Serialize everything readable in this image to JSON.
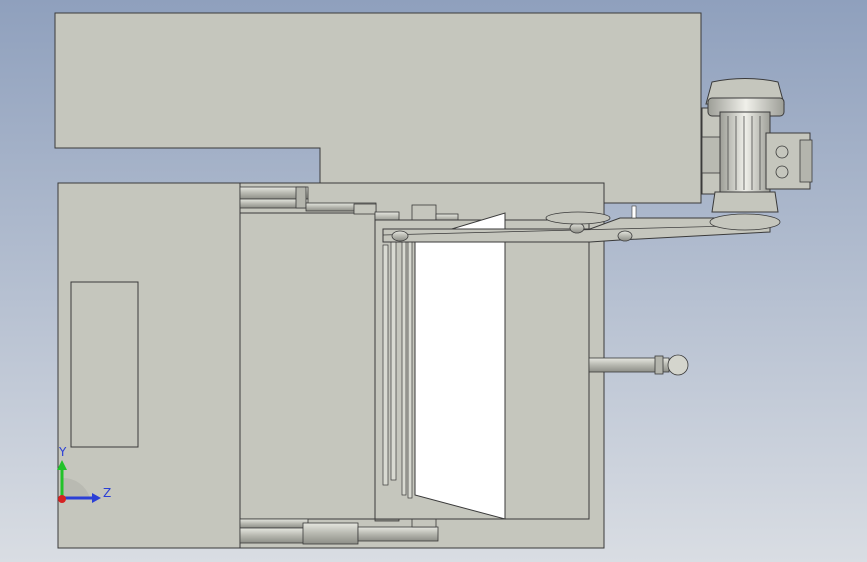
{
  "viewport": {
    "background_top": "#8fa0bd",
    "background_bottom": "#d9dde3"
  },
  "colors": {
    "part_fill": "#c5c6bd",
    "part_stroke": "#3a3a3a",
    "panel_white": "#ffffff",
    "shadow": "#9a9b94",
    "axis_x": "#d62222",
    "axis_y": "#22c22a",
    "axis_z": "#2b3fd6"
  },
  "triad": {
    "y_label": "Y",
    "z_label": "Z"
  }
}
